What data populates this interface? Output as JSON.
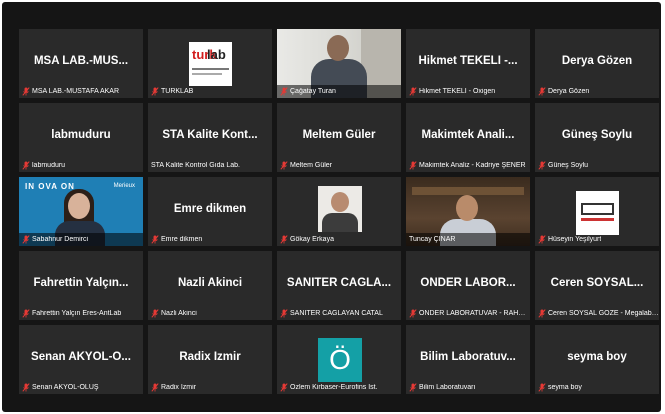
{
  "colors": {
    "background": "#151515",
    "tile": "#2a2a2a",
    "active_speaker_border": "#d6e04a",
    "muted_mic": "#e53935"
  },
  "participants": [
    {
      "display": "MSA LAB.-MUS...",
      "caption": "MSA LAB.-MUSTAFA AKAR",
      "muted": true
    },
    {
      "display": "",
      "caption": "TURKLAB",
      "muted": true,
      "media": "turklab-logo"
    },
    {
      "display": "",
      "caption": "Çağatay Turan",
      "muted": true,
      "media": "video"
    },
    {
      "display": "Hikmet TEKELİ -...",
      "caption": "Hikmet TEKELİ - Oxigen",
      "muted": true
    },
    {
      "display": "Derya Gözen",
      "caption": "Derya Gözen",
      "muted": true
    },
    {
      "display": "labmuduru",
      "caption": "labmuduru",
      "muted": true
    },
    {
      "display": "STA Kalite Kont...",
      "caption": "STA Kalite Kontrol Gıda Lab.",
      "muted": false
    },
    {
      "display": "Meltem Güler",
      "caption": "Meltem Güler",
      "muted": true
    },
    {
      "display": "Makimtek Anali...",
      "caption": "Makimtek Analiz - Kadriye ŞENER",
      "muted": true
    },
    {
      "display": "Güneş Soylu",
      "caption": "Güneş Soylu",
      "muted": true
    },
    {
      "display": "",
      "caption": "Sabahnur Demirci",
      "muted": true,
      "media": "video",
      "overlay_text": "IN OVA ON",
      "overlay_brand": "Merieux"
    },
    {
      "display": "Emre dikmen",
      "caption": "Emre dikmen",
      "muted": true
    },
    {
      "display": "",
      "caption": "Gökay Erkaya",
      "muted": true,
      "media": "profile-photo"
    },
    {
      "display": "",
      "caption": "Tuncay ÇINAR",
      "muted": false,
      "media": "video",
      "active_speaker": true
    },
    {
      "display": "",
      "caption": "Hüseyin Yeşilyurt",
      "muted": true,
      "media": "uzman-logo"
    },
    {
      "display": "Fahrettin Yalçın...",
      "caption": "Fahrettin Yalçın Eres-AntLab",
      "muted": true
    },
    {
      "display": "Nazli Akinci",
      "caption": "Nazli Akinci",
      "muted": true
    },
    {
      "display": "SANİTER CAGLA...",
      "caption": "SANİTER CAGLAYAN CATAL",
      "muted": true
    },
    {
      "display": "ÖNDER LABOR...",
      "caption": "ÖNDER LABORATUVAR - RAHMA...",
      "muted": true
    },
    {
      "display": "Ceren SOYSAL...",
      "caption": "Ceren SOYSAL GÖZE - Megalab M...",
      "muted": true
    },
    {
      "display": "Senan AKYOL-O...",
      "caption": "Senan AKYOL-OLUŞ",
      "muted": true
    },
    {
      "display": "Radix İzmir",
      "caption": "Radix İzmir",
      "muted": true
    },
    {
      "display": "",
      "caption": "Özlem Kirbaser-Eurofins İst.",
      "muted": true,
      "media": "letter-avatar",
      "avatar_letter": "Ö"
    },
    {
      "display": "Bilim Laboratuv...",
      "caption": "Bilim Laboratuvarı",
      "muted": true
    },
    {
      "display": "seyma boy",
      "caption": "seyma boy",
      "muted": true
    }
  ],
  "logos": {
    "turklab_part1": "turk",
    "turklab_part2": "lab"
  }
}
